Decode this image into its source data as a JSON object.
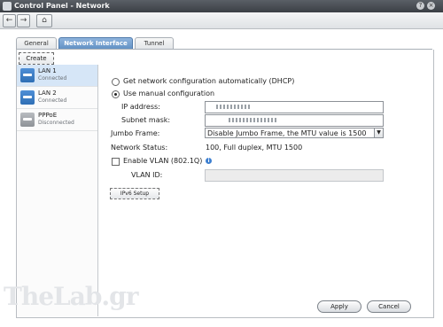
{
  "window": {
    "title": "Control Panel - Network"
  },
  "toolbar": {
    "back_icon": "back-arrow-icon",
    "forward_icon": "forward-arrow-icon",
    "home_icon": "home-icon"
  },
  "tabs": [
    {
      "label": "General",
      "active": false
    },
    {
      "label": "Network Interface",
      "active": true
    },
    {
      "label": "Tunnel",
      "active": false
    }
  ],
  "create_label": "Create",
  "interfaces": [
    {
      "name": "LAN 1",
      "status": "Connected",
      "selected": true
    },
    {
      "name": "LAN 2",
      "status": "Connected",
      "selected": false
    },
    {
      "name": "PPPoE",
      "status": "Disconnected",
      "selected": false
    }
  ],
  "form": {
    "dhcp_label": "Get network configuration automatically (DHCP)",
    "manual_label": "Use manual configuration",
    "ip_label": "IP address:",
    "subnet_label": "Subnet mask:",
    "jumbo_label": "Jumbo Frame:",
    "jumbo_value": "Disable Jumbo Frame, the MTU value is 1500",
    "status_label": "Network Status:",
    "status_value": "100, Full duplex, MTU 1500",
    "vlan_label": "Enable VLAN (802.1Q)",
    "vlan_id_label": "VLAN ID:",
    "ipv6_label": "IPv6 Setup"
  },
  "buttons": {
    "apply": "Apply",
    "cancel": "Cancel"
  },
  "watermark": "TheLab.gr",
  "colors": {
    "active_tab": "#5f8fc3",
    "selected_row": "#d6e6f7",
    "titlebar": "#3b3f45"
  }
}
